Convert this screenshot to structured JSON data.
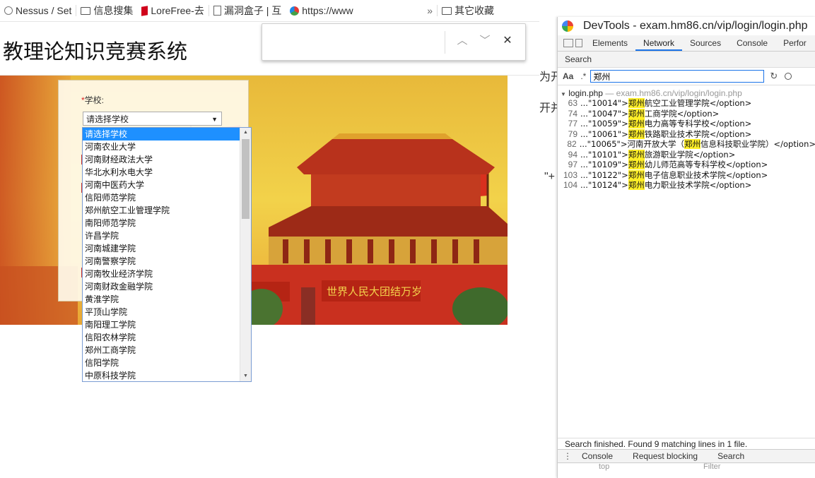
{
  "bookmarks": [
    {
      "label": "Nessus / Set",
      "icon": "nessus-icon"
    },
    {
      "label": "信息搜集",
      "icon": "folder-icon"
    },
    {
      "label": "LoreFree-去",
      "icon": "lorefree-icon"
    },
    {
      "label": "漏洞盒子 | 互",
      "icon": "page-icon"
    },
    {
      "label": "https://www",
      "icon": "colorful-star-icon"
    }
  ],
  "bookmarks_overflow": "»",
  "other_bookmarks": "其它收藏",
  "page_title": "教理论知识竞赛系统",
  "findbar": {
    "up": "︿",
    "down": "﹀",
    "close": "✕"
  },
  "login": {
    "required_mark": "*",
    "school_label": "学校:",
    "school_selected": "请选择学校"
  },
  "school_options": [
    "请选择学校",
    "河南农业大学",
    "河南财经政法大学",
    "华北水利水电大学",
    "河南中医药大学",
    "信阳师范学院",
    "郑州航空工业管理学院",
    "南阳师范学院",
    "许昌学院",
    "河南城建学院",
    "河南警察学院",
    "河南牧业经济学院",
    "河南财政金融学院",
    "黄淮学院",
    "平顶山学院",
    "南阳理工学院",
    "信阳农林学院",
    "郑州工商学院",
    "信阳学院",
    "中原科技学院"
  ],
  "fragments": {
    "a": "为开",
    "b": "开并",
    "c": "\"+"
  },
  "devtools": {
    "title": "DevTools - exam.hm86.cn/vip/login/login.php",
    "tabs": [
      "Elements",
      "Network",
      "Sources",
      "Console",
      "Perfor"
    ],
    "active_tab": "Network",
    "search_header": "Search",
    "aa": "Aa",
    "regex": ".*",
    "query": "郑州",
    "file": "login.php",
    "file_path": "— exam.hm86.cn/vip/login/login.php",
    "results": [
      {
        "line": "63",
        "pre": "...\"10014\">",
        "match": "郑州",
        "post": "航空工业管理学院</option>"
      },
      {
        "line": "74",
        "pre": "...\"10047\">",
        "match": "郑州",
        "post": "工商学院</option>"
      },
      {
        "line": "77",
        "pre": "...\"10059\">",
        "match": "郑州",
        "post": "电力高等专科学校</option>"
      },
      {
        "line": "79",
        "pre": "...\"10061\">",
        "match": "郑州",
        "post": "铁路职业技术学院</option>"
      },
      {
        "line": "82",
        "pre": "...\"10065\">河南开放大学（",
        "match": "郑州",
        "post": "信息科技职业学院）</option>"
      },
      {
        "line": "94",
        "pre": "...\"10101\">",
        "match": "郑州",
        "post": "旅游职业学院</option>"
      },
      {
        "line": "97",
        "pre": "...\"10109\">",
        "match": "郑州",
        "post": "幼儿师范高等专科学校</option>"
      },
      {
        "line": "103",
        "pre": "...\"10122\">",
        "match": "郑州",
        "post": "电子信息职业技术学院</option>"
      },
      {
        "line": "104",
        "pre": "...\"10124\">",
        "match": "郑州",
        "post": "电力职业技术学院</option>"
      }
    ],
    "status": "Search finished.  Found 9 matching lines in 1 file.",
    "drawer_tabs": [
      "Console",
      "Request blocking",
      "Search"
    ],
    "drawer_menu": "⋮",
    "drawer_sub": {
      "a": "top",
      "b": "Filter"
    }
  }
}
